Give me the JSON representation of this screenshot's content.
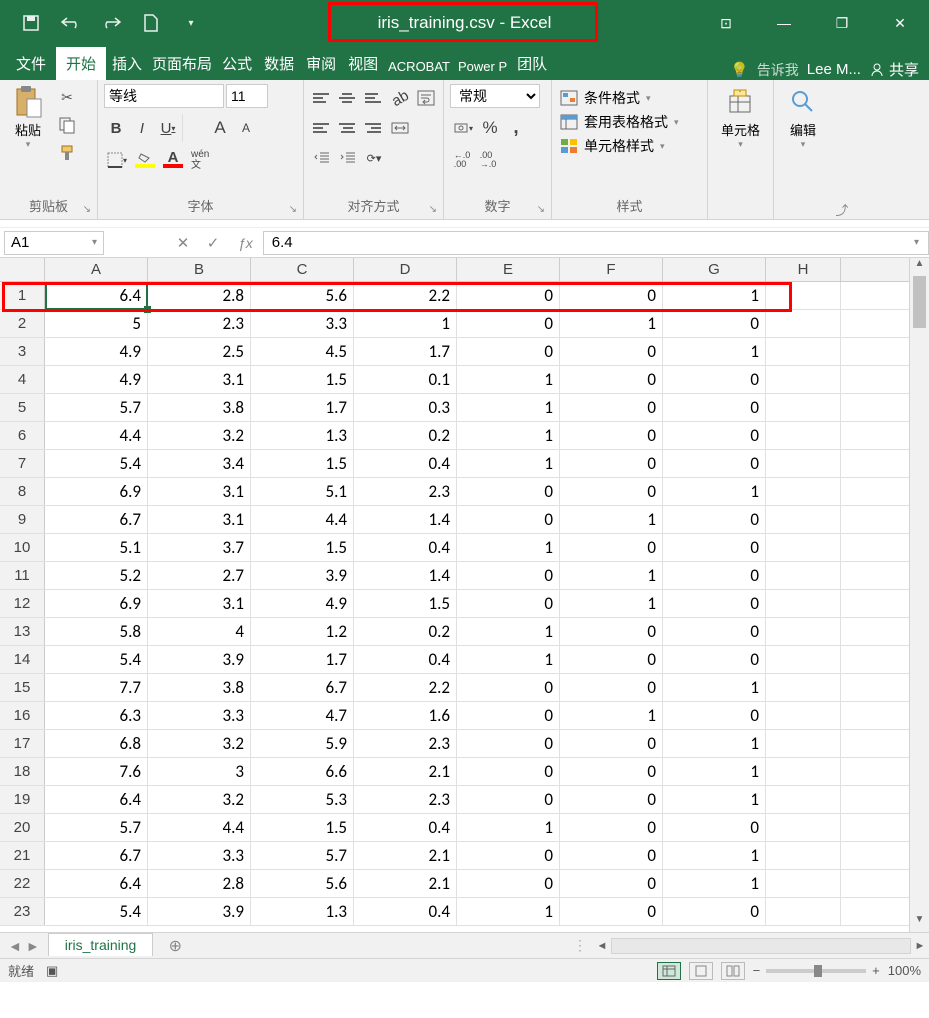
{
  "app": {
    "title": "iris_training.csv - Excel"
  },
  "win_controls": {
    "restore_a": "⊡",
    "minimize": "—",
    "restore_b": "❐",
    "close": "✕"
  },
  "tabs": {
    "file": "文件",
    "home": "开始",
    "insert": "插入",
    "page_layout": "页面布局",
    "formulas": "公式",
    "data": "数据",
    "review": "审阅",
    "view": "视图",
    "acrobat": "ACROBAT",
    "powerp": "Power P",
    "team": "团队",
    "tell_me": "告诉我",
    "user": "Lee M...",
    "share": "共享"
  },
  "ribbon": {
    "clipboard": {
      "label": "剪贴板",
      "paste": "粘贴"
    },
    "font": {
      "label": "字体",
      "name": "等线",
      "size": "11",
      "bold": "B",
      "italic": "I",
      "underline": "U",
      "grow": "A",
      "shrink": "A",
      "phonetic": "wén\n文"
    },
    "align": {
      "label": "对齐方式"
    },
    "number": {
      "label": "数字",
      "format": "常规",
      "inc_dec_a": "←.0\n.00",
      "inc_dec_b": ".00\n→.0"
    },
    "styles": {
      "label": "样式",
      "cond_fmt": "条件格式",
      "tbl_fmt": "套用表格格式",
      "cell_style": "单元格样式"
    },
    "cells": {
      "label": "单元格"
    },
    "edit": {
      "label": "编辑"
    }
  },
  "formula_bar": {
    "name_box": "A1",
    "formula": "6.4"
  },
  "columns": [
    "A",
    "B",
    "C",
    "D",
    "E",
    "F",
    "G",
    "H"
  ],
  "sheet": {
    "rows": [
      {
        "n": 1,
        "c": [
          "6.4",
          "2.8",
          "5.6",
          "2.2",
          "0",
          "0",
          "1",
          ""
        ]
      },
      {
        "n": 2,
        "c": [
          "5",
          "2.3",
          "3.3",
          "1",
          "0",
          "1",
          "0",
          ""
        ]
      },
      {
        "n": 3,
        "c": [
          "4.9",
          "2.5",
          "4.5",
          "1.7",
          "0",
          "0",
          "1",
          ""
        ]
      },
      {
        "n": 4,
        "c": [
          "4.9",
          "3.1",
          "1.5",
          "0.1",
          "1",
          "0",
          "0",
          ""
        ]
      },
      {
        "n": 5,
        "c": [
          "5.7",
          "3.8",
          "1.7",
          "0.3",
          "1",
          "0",
          "0",
          ""
        ]
      },
      {
        "n": 6,
        "c": [
          "4.4",
          "3.2",
          "1.3",
          "0.2",
          "1",
          "0",
          "0",
          ""
        ]
      },
      {
        "n": 7,
        "c": [
          "5.4",
          "3.4",
          "1.5",
          "0.4",
          "1",
          "0",
          "0",
          ""
        ]
      },
      {
        "n": 8,
        "c": [
          "6.9",
          "3.1",
          "5.1",
          "2.3",
          "0",
          "0",
          "1",
          ""
        ]
      },
      {
        "n": 9,
        "c": [
          "6.7",
          "3.1",
          "4.4",
          "1.4",
          "0",
          "1",
          "0",
          ""
        ]
      },
      {
        "n": 10,
        "c": [
          "5.1",
          "3.7",
          "1.5",
          "0.4",
          "1",
          "0",
          "0",
          ""
        ]
      },
      {
        "n": 11,
        "c": [
          "5.2",
          "2.7",
          "3.9",
          "1.4",
          "0",
          "1",
          "0",
          ""
        ]
      },
      {
        "n": 12,
        "c": [
          "6.9",
          "3.1",
          "4.9",
          "1.5",
          "0",
          "1",
          "0",
          ""
        ]
      },
      {
        "n": 13,
        "c": [
          "5.8",
          "4",
          "1.2",
          "0.2",
          "1",
          "0",
          "0",
          ""
        ]
      },
      {
        "n": 14,
        "c": [
          "5.4",
          "3.9",
          "1.7",
          "0.4",
          "1",
          "0",
          "0",
          ""
        ]
      },
      {
        "n": 15,
        "c": [
          "7.7",
          "3.8",
          "6.7",
          "2.2",
          "0",
          "0",
          "1",
          ""
        ]
      },
      {
        "n": 16,
        "c": [
          "6.3",
          "3.3",
          "4.7",
          "1.6",
          "0",
          "1",
          "0",
          ""
        ]
      },
      {
        "n": 17,
        "c": [
          "6.8",
          "3.2",
          "5.9",
          "2.3",
          "0",
          "0",
          "1",
          ""
        ]
      },
      {
        "n": 18,
        "c": [
          "7.6",
          "3",
          "6.6",
          "2.1",
          "0",
          "0",
          "1",
          ""
        ]
      },
      {
        "n": 19,
        "c": [
          "6.4",
          "3.2",
          "5.3",
          "2.3",
          "0",
          "0",
          "1",
          ""
        ]
      },
      {
        "n": 20,
        "c": [
          "5.7",
          "4.4",
          "1.5",
          "0.4",
          "1",
          "0",
          "0",
          ""
        ]
      },
      {
        "n": 21,
        "c": [
          "6.7",
          "3.3",
          "5.7",
          "2.1",
          "0",
          "0",
          "1",
          ""
        ]
      },
      {
        "n": 22,
        "c": [
          "6.4",
          "2.8",
          "5.6",
          "2.1",
          "0",
          "0",
          "1",
          ""
        ]
      },
      {
        "n": 23,
        "c": [
          "5.4",
          "3.9",
          "1.3",
          "0.4",
          "1",
          "0",
          "0",
          ""
        ]
      }
    ]
  },
  "sheet_tabs": {
    "active": "iris_training"
  },
  "status": {
    "ready": "就绪",
    "zoom": "100%"
  }
}
